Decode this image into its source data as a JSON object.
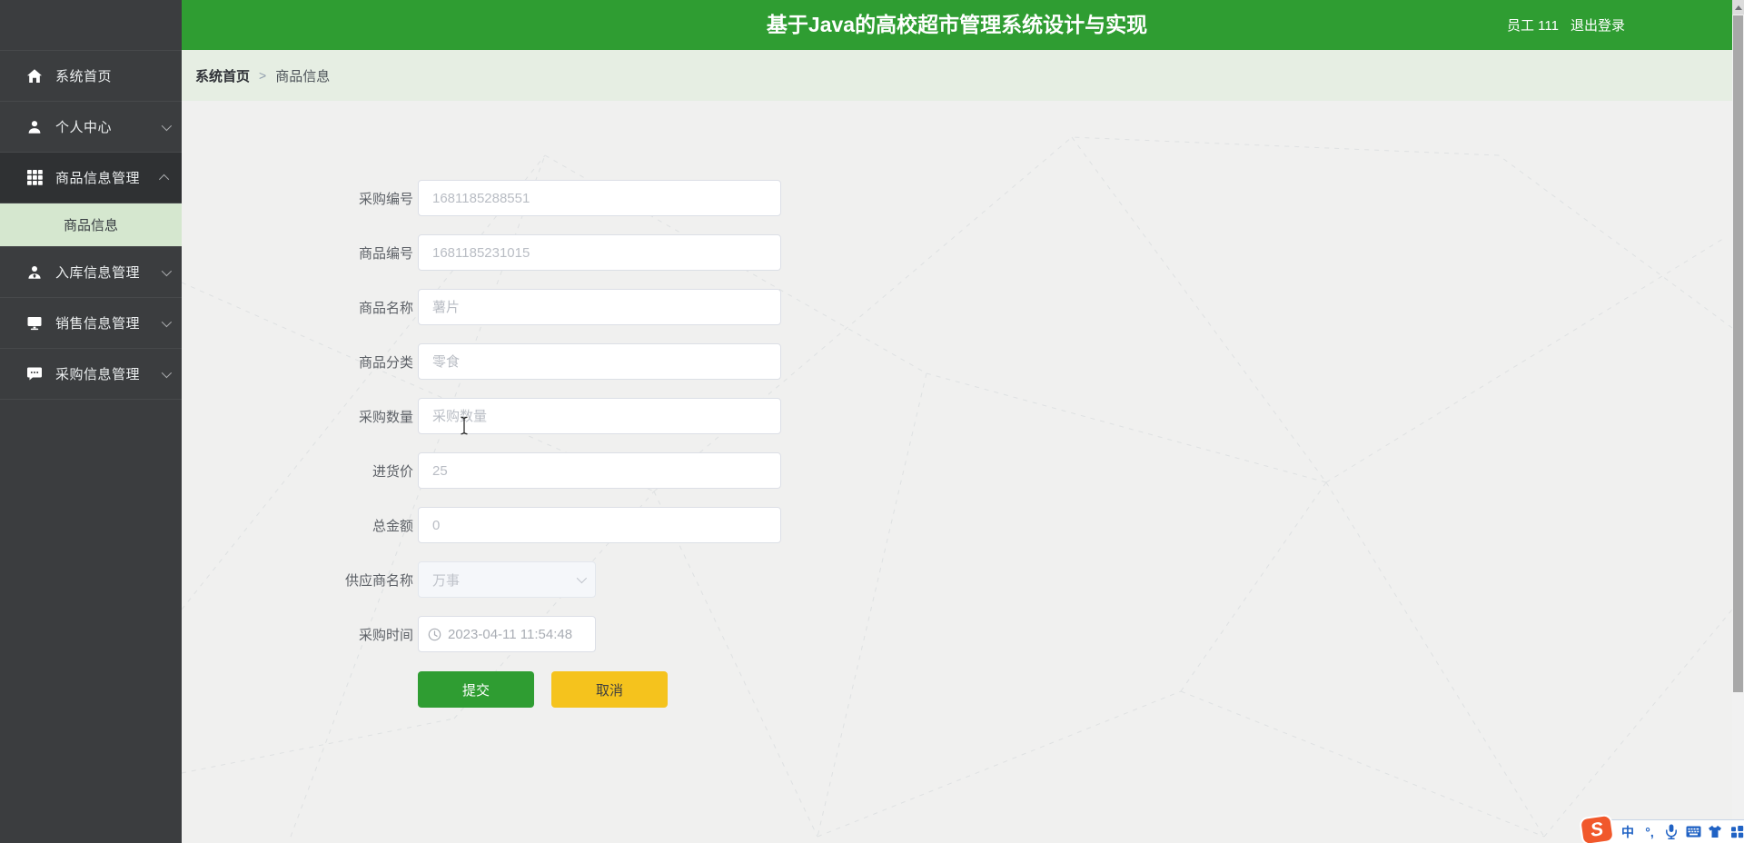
{
  "theme": {
    "header-green": "#2f9d32",
    "sidebar-bg": "#3b3d3f",
    "sidebar-active-bg": "#2f3133",
    "submenu-active-bg": "#d5e7cf",
    "breadcrumb-bg": "#e6eee3",
    "content-bg": "#f0f0ef",
    "submit-green": "#2f9d32",
    "cancel-yellow": "#f5c31d",
    "ime-blue": "#2062c4",
    "ime-orange": "#f1582b"
  },
  "header": {
    "title": "基于Java的高校超市管理系统设计与实现",
    "user": "员工 111",
    "logout_label": "退出登录"
  },
  "breadcrumb": {
    "home": "系统首页",
    "separator": ">",
    "current": "商品信息"
  },
  "sidebar": {
    "items": [
      {
        "label": "系统首页",
        "icon": "home-icon"
      },
      {
        "label": "个人中心",
        "icon": "user-icon"
      },
      {
        "label": "商品信息管理",
        "icon": "grid-icon",
        "children": [
          {
            "label": "商品信息"
          }
        ]
      },
      {
        "label": "入库信息管理",
        "icon": "user-badge-icon"
      },
      {
        "label": "销售信息管理",
        "icon": "monitor-icon"
      },
      {
        "label": "采购信息管理",
        "icon": "chat-icon"
      }
    ]
  },
  "form": {
    "fields": [
      {
        "label": "采购编号",
        "text": "1681185288551",
        "type": "text"
      },
      {
        "label": "商品编号",
        "text": "1681185231015",
        "type": "text"
      },
      {
        "label": "商品名称",
        "text": "薯片",
        "type": "text"
      },
      {
        "label": "商品分类",
        "text": "零食",
        "type": "text"
      },
      {
        "label": "采购数量",
        "text": "采购数量",
        "type": "text"
      },
      {
        "label": "进货价",
        "text": "25",
        "type": "text"
      },
      {
        "label": "总金额",
        "text": "0",
        "type": "text"
      },
      {
        "label": "供应商名称",
        "text": "万事",
        "type": "select"
      },
      {
        "label": "采购时间",
        "text": "2023-04-11 11:54:48",
        "type": "datetime"
      }
    ],
    "submit_label": "提交",
    "cancel_label": "取消"
  },
  "ime": {
    "chinese_glyph": "中",
    "punct_glyph": "°,",
    "logo_glyph": "S"
  }
}
